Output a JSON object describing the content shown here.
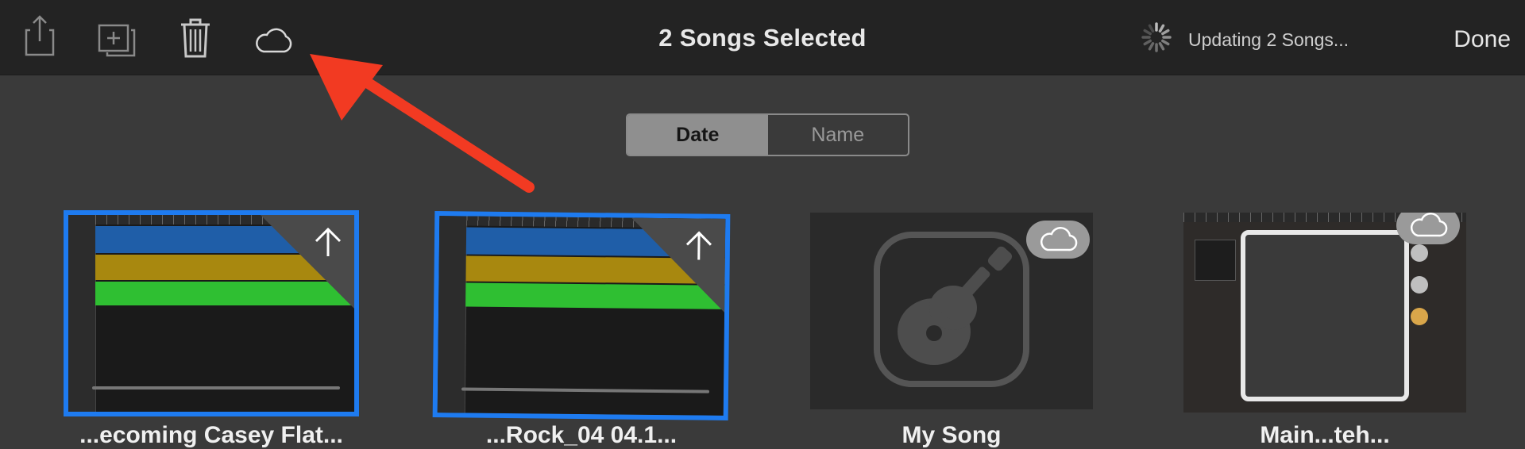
{
  "toolbar": {
    "title": "2 Songs Selected",
    "status_text": "Updating 2 Songs...",
    "done_label": "Done",
    "icons": [
      "share-icon",
      "duplicate-icon",
      "trash-icon",
      "icloud-icon",
      "activity-spinner-icon"
    ]
  },
  "sort": {
    "options": [
      "Date",
      "Name"
    ],
    "selected": "Date"
  },
  "songs": [
    {
      "label": "...ecoming Casey Flat...",
      "selected": true,
      "state": "uploading"
    },
    {
      "label": "...Rock_04 04.1...",
      "selected": true,
      "state": "uploading"
    },
    {
      "label": "My Song",
      "selected": false,
      "state": "in-icloud"
    },
    {
      "label": "Main...teh...",
      "selected": false,
      "state": "in-icloud"
    }
  ],
  "colors": {
    "selection": "#1e7bf0",
    "annotation_arrow": "#f23a22",
    "track_blue": "#1f5ea8",
    "track_yellow": "#a8880f",
    "track_green": "#2fbf32"
  }
}
